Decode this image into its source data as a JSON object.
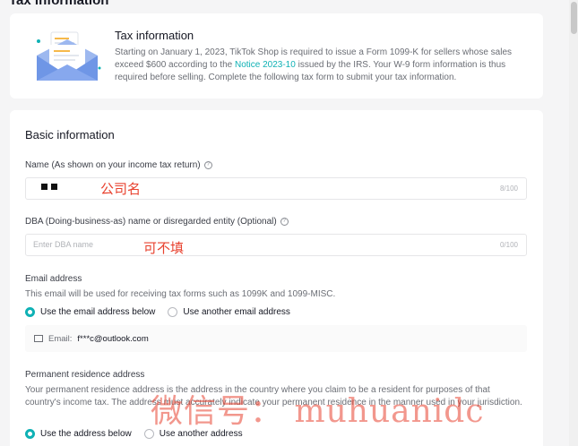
{
  "page": {
    "heading": "Tax information"
  },
  "tax_card": {
    "title": "Tax information",
    "desc_before": "Starting on January 1, 2023, TikTok Shop is required to issue a Form 1099-K for sellers whose sales exceed $600 according to the ",
    "desc_link": "Notice 2023-10",
    "desc_after": " issued by the IRS. Your W-9 form information is thus required before selling. Complete the following tax form to submit your tax information."
  },
  "basic": {
    "title": "Basic information",
    "name_label": "Name (As shown on your income tax return)",
    "name_counter": "8/100",
    "name_annotation": "公司名",
    "dba_label": "DBA (Doing-business-as) name or disregarded entity (Optional)",
    "dba_placeholder": "Enter DBA name",
    "dba_counter": "0/100",
    "dba_annotation": "可不填",
    "email_label": "Email address",
    "email_helper": "This email will be used for receiving tax forms such as 1099K and 1099-MISC.",
    "email_opt1": "Use the email address below",
    "email_opt2": "Use another email address",
    "email_prefix": "Email:",
    "email_value": "f***c@outlook.com",
    "addr_label": "Permanent residence address",
    "addr_helper": "Your permanent residence address is the address in the country where you claim to be a resident for purposes of that country's income tax. The address must accurately indicate your permanent residence in the manner used in your jurisdiction.",
    "addr_opt1": "Use the address below",
    "addr_opt2": "Use another address"
  },
  "watermark": "微信号： muhuanidc",
  "colors": {
    "accent": "#0fb1b5",
    "annotation": "#e8422f"
  }
}
